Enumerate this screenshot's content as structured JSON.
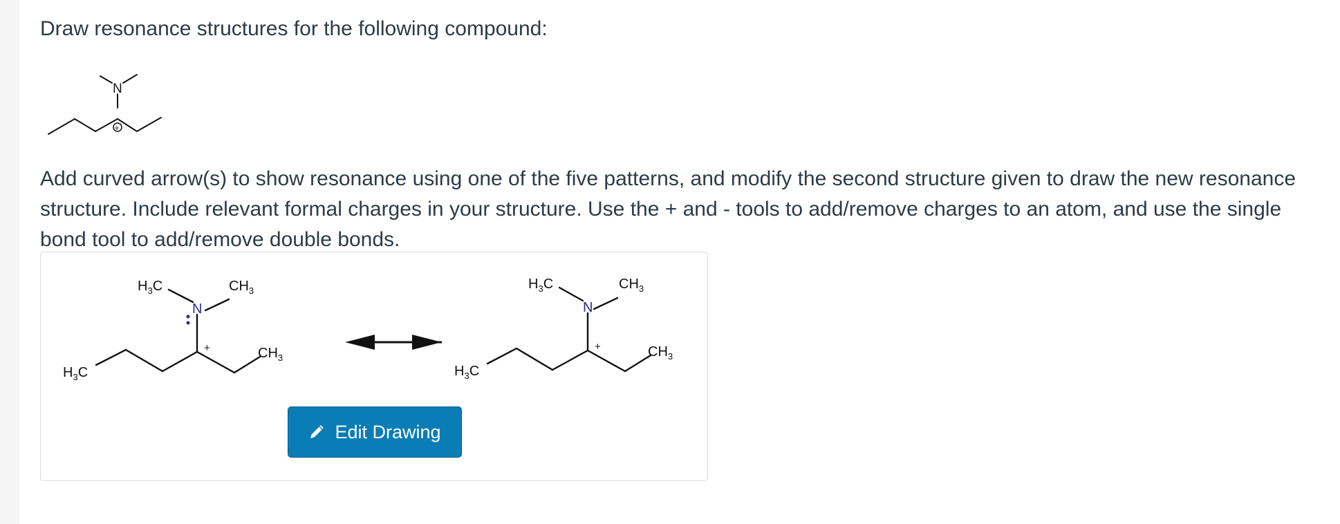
{
  "question": {
    "prompt": "Draw resonance structures for the following compound:",
    "instructions": "Add curved arrow(s) to show resonance using one of the five patterns, and modify the second structure given to draw the new resonance structure. Include relevant formal charges in your structure. Use the + and - tools to add/remove charges to an atom, and use the single bond tool to add/remove double bonds."
  },
  "compound_labels": {
    "nitrogen": "N",
    "charge": "+"
  },
  "drawing": {
    "structure1": {
      "h3c_top": "H3C",
      "ch3_top": "CH3",
      "nitrogen": "N",
      "h3c_left": "H3C",
      "ch3_right": "CH3",
      "charge": "+"
    },
    "structure2": {
      "h3c_top": "H3C",
      "ch3_top": "CH3",
      "nitrogen": "N",
      "h3c_left": "H3C",
      "ch3_right": "CH3",
      "charge": "+"
    },
    "edit_button_label": "Edit Drawing",
    "icons": {
      "edit": "pencil-icon",
      "resonance": "double-headed-arrow-icon"
    },
    "colors": {
      "bond": "#111111",
      "nitrogen": "#2b2b8f",
      "button": "#0a7cb6"
    }
  }
}
